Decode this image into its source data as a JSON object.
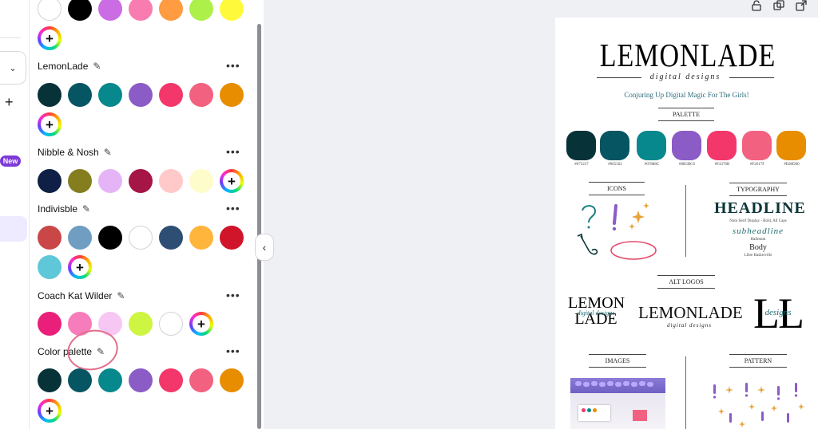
{
  "sidebar_rail": {
    "new_badge": "New",
    "add_glyph": "+",
    "dropdown_glyph": "⌄"
  },
  "colors_panel": {
    "more_glyph": "•••",
    "pencil_glyph": "✎",
    "add_glyph": "+",
    "top_row": [
      "#ffffff",
      "#000000",
      "#cc6ce4",
      "#f97cb0",
      "#ff9b40",
      "#aef04a",
      "#fff93c"
    ],
    "palettes": [
      {
        "name": "LemonLade",
        "colors": [
          "#073237",
          "#065562",
          "#07888C",
          "#8B5BC6",
          "#F4376B",
          "#F2617F",
          "#E88D00"
        ]
      },
      {
        "name": "Nibble & Nosh",
        "colors": [
          "#0f1f46",
          "#847e1f",
          "#e5b4f6",
          "#a51545",
          "#ffc9c9",
          "#fffccc"
        ]
      },
      {
        "name": "Indivisble",
        "colors": [
          "#c94747",
          "#6f9ec2",
          "#000000",
          "#ffffff",
          "#2f4e73",
          "#ffb43c",
          "#d0142a",
          "#5fc8d8"
        ]
      },
      {
        "name": "Coach Kat Wilder",
        "colors": [
          "#ea1f7a",
          "#f77cbb",
          "#f7c7f3",
          "#cdf542",
          "#ffffff"
        ]
      },
      {
        "name": "Color palette",
        "colors": [
          "#073237",
          "#065562",
          "#07888C",
          "#8B5BC6",
          "#F4376B",
          "#F2617F",
          "#E88D00"
        ]
      }
    ]
  },
  "collapse_glyph": "‹",
  "brand_board": {
    "title": "LEMONLADE",
    "subtitle": "digital designs",
    "tagline": "Conjuring Up Digital Magic For The Girls!",
    "palette_heading": "PALETTE",
    "palette": [
      {
        "color": "#073237",
        "label": "#073237"
      },
      {
        "color": "#065562",
        "label": "#065562"
      },
      {
        "color": "#07888C",
        "label": "#07888C"
      },
      {
        "color": "#8B5BC6",
        "label": "#8B5BC6"
      },
      {
        "color": "#F4376B",
        "label": "#F4376B"
      },
      {
        "color": "#F2617F",
        "label": "#F2617F"
      },
      {
        "color": "#E88D00",
        "label": "#E88D00"
      }
    ],
    "icons_heading": "ICONS",
    "typography_heading": "TYPOGRAPHY",
    "headline": "HEADLINE",
    "headline_font": "Noto Serif Display - Bold, All Caps",
    "subheadline": "subheadline",
    "subheadline_font": "Halimum",
    "body": "Body",
    "body_font": "Libre Baskerville",
    "alt_logos_heading": "ALT LOGOS",
    "alt_logo_1": "LEMON LADE",
    "alt_logo_1_script": "digital designs",
    "alt_logo_2": "LEMONLADE",
    "alt_logo_2_script": "digital designs",
    "alt_logo_3": "LL",
    "alt_logo_3_script": "designs",
    "images_heading": "IMAGES",
    "pattern_heading": "PATTERN"
  }
}
